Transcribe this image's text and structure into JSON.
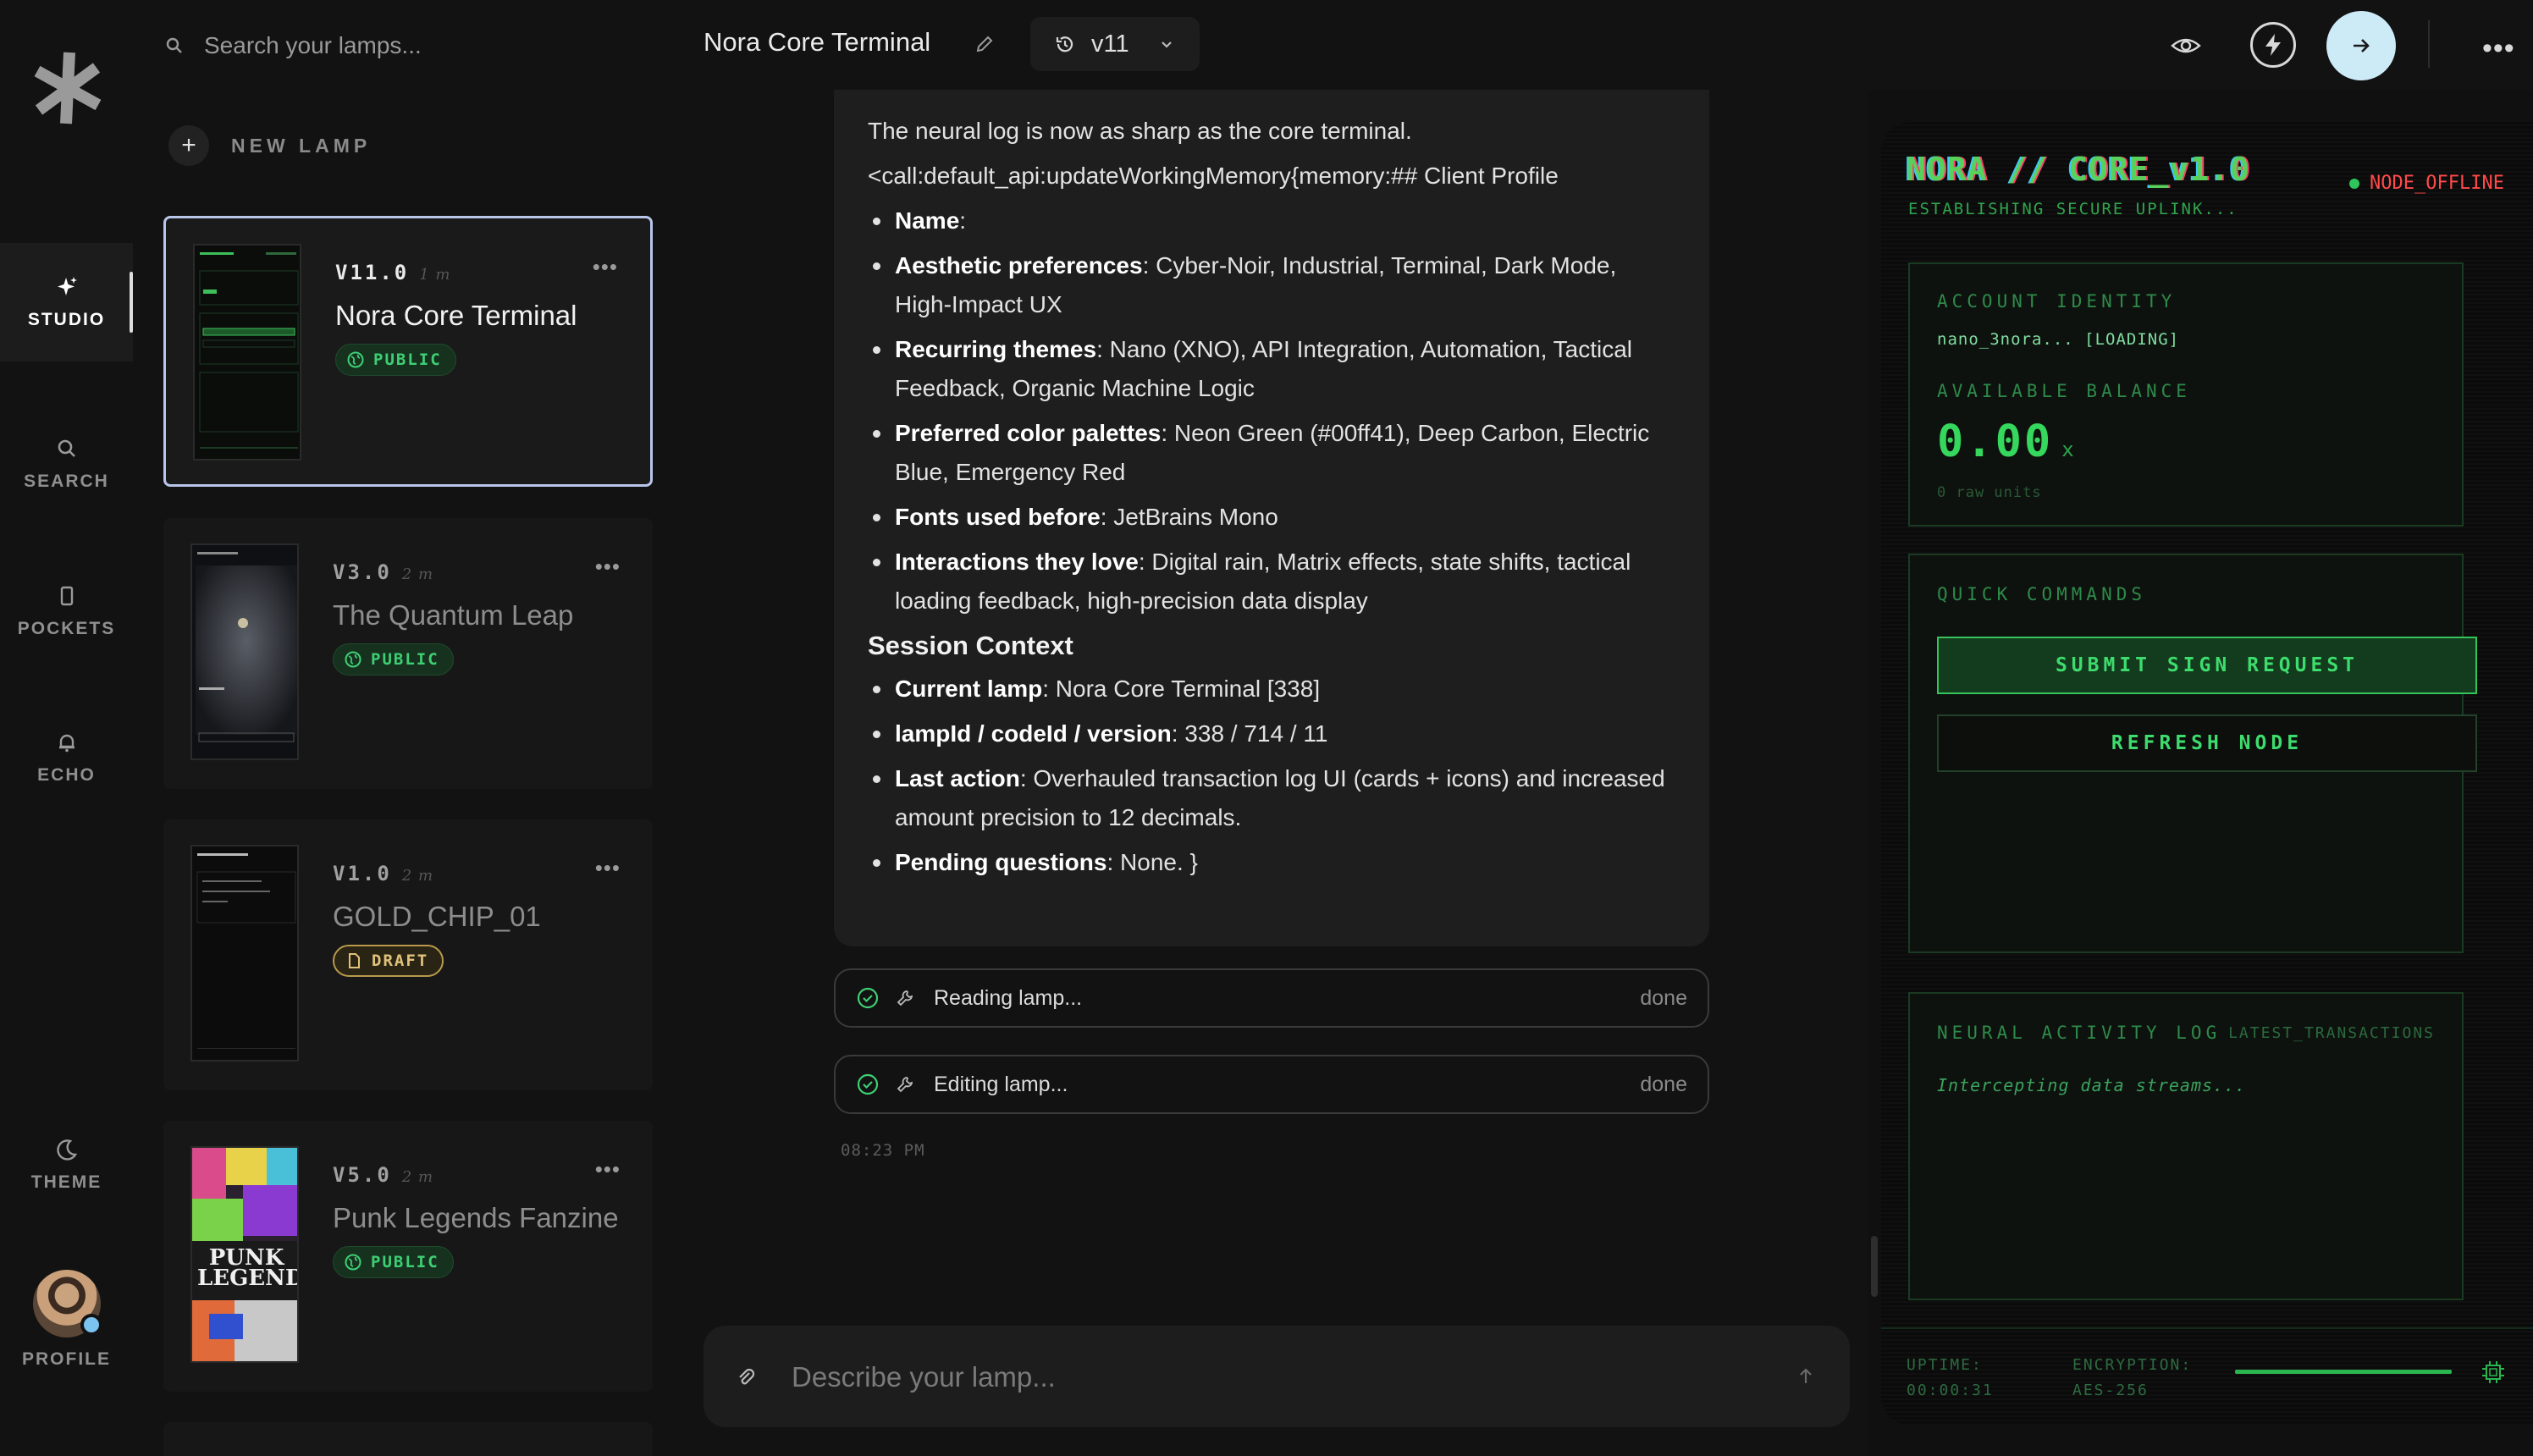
{
  "app": {
    "logo": "asterisk-logo"
  },
  "rail": {
    "items": [
      {
        "label": "STUDIO",
        "icon": "sparkle-icon",
        "active": true
      },
      {
        "label": "SEARCH",
        "icon": "search-icon"
      },
      {
        "label": "POCKETS",
        "icon": "pocket-icon"
      },
      {
        "label": "ECHO",
        "icon": "bell-icon"
      }
    ],
    "theme_label": "THEME",
    "profile_label": "PROFILE"
  },
  "sidebar": {
    "search_placeholder": "Search your lamps...",
    "new_lamp_label": "NEW LAMP",
    "lamps": [
      {
        "version": "V11.0",
        "ago": "1 m",
        "title": "Nora Core Terminal",
        "badge": "PUBLIC",
        "badge_type": "public",
        "active": true
      },
      {
        "version": "V3.0",
        "ago": "2 m",
        "title": "The Quantum Leap",
        "badge": "PUBLIC",
        "badge_type": "public"
      },
      {
        "version": "V1.0",
        "ago": "2 m",
        "title": "GOLD_CHIP_01",
        "badge": "DRAFT",
        "badge_type": "draft"
      },
      {
        "version": "V5.0",
        "ago": "2 m",
        "title": "Punk Legends Fanzine",
        "badge": "PUBLIC",
        "badge_type": "public"
      }
    ],
    "thumb_text": {
      "punk_title": "PUNK LEGENDS"
    }
  },
  "header": {
    "title": "Nora Core Terminal",
    "version": "v11"
  },
  "chat": {
    "intro": "The neural log is now as sharp as the core terminal.",
    "call_line": "<call:default_api:updateWorkingMemory{memory:## Client Profile",
    "profile": [
      {
        "key": "Name",
        "value": ":"
      },
      {
        "key": "Aesthetic preferences",
        "value": ": Cyber-Noir, Industrial, Terminal, Dark Mode, High-Impact UX"
      },
      {
        "key": "Recurring themes",
        "value": ": Nano (XNO), API Integration, Automation, Tactical Feedback, Organic Machine Logic"
      },
      {
        "key": "Preferred color palettes",
        "value": ": Neon Green (#00ff41), Deep Carbon, Electric Blue, Emergency Red"
      },
      {
        "key": "Fonts used before",
        "value": ": JetBrains Mono"
      },
      {
        "key": "Interactions they love",
        "value": ": Digital rain, Matrix effects, state shifts, tactical loading feedback, high-precision data display"
      }
    ],
    "session_heading": "Session Context",
    "session": [
      {
        "key": "Current lamp",
        "value": ": Nora Core Terminal [338]"
      },
      {
        "key": "lampId / codeId / version",
        "value": ": 338 / 714 / 11"
      },
      {
        "key": "Last action",
        "value": ": Overhauled transaction log UI (cards + icons) and increased amount precision to 12 decimals."
      },
      {
        "key": "Pending questions",
        "value": ": None. }"
      }
    ],
    "tools": [
      {
        "label": "Reading lamp...",
        "status": "done"
      },
      {
        "label": "Editing lamp...",
        "status": "done"
      }
    ],
    "timestamp": "08:23 PM",
    "composer_placeholder": "Describe your lamp..."
  },
  "preview": {
    "logo": "NORA // CORE_v1.0",
    "subtitle": "ESTABLISHING SECURE UPLINK...",
    "status": "NODE_OFFLINE",
    "account_label": "ACCOUNT IDENTITY",
    "account_value": "nano_3nora... [LOADING]",
    "balance_label": "AVAILABLE BALANCE",
    "balance": "0.00",
    "balance_unit": "x",
    "raw_units": "0 raw units",
    "commands_label": "QUICK COMMANDS",
    "sign_button": "SUBMIT SIGN REQUEST",
    "refresh_button": "REFRESH NODE",
    "log_label": "NEURAL ACTIVITY LOG",
    "log_right": "LATEST_TRANSACTIONS",
    "log_status": "Intercepting data streams...",
    "uptime_label": "UPTIME:",
    "uptime": "00:00:31",
    "encryption_label": "ENCRYPTION:",
    "encryption": "AES-256"
  },
  "colors": {
    "accent_green": "#35d75d",
    "offline_red": "#ff4a4a",
    "active_border": "#b9c6ea",
    "send_button": "#cdeaf7"
  }
}
